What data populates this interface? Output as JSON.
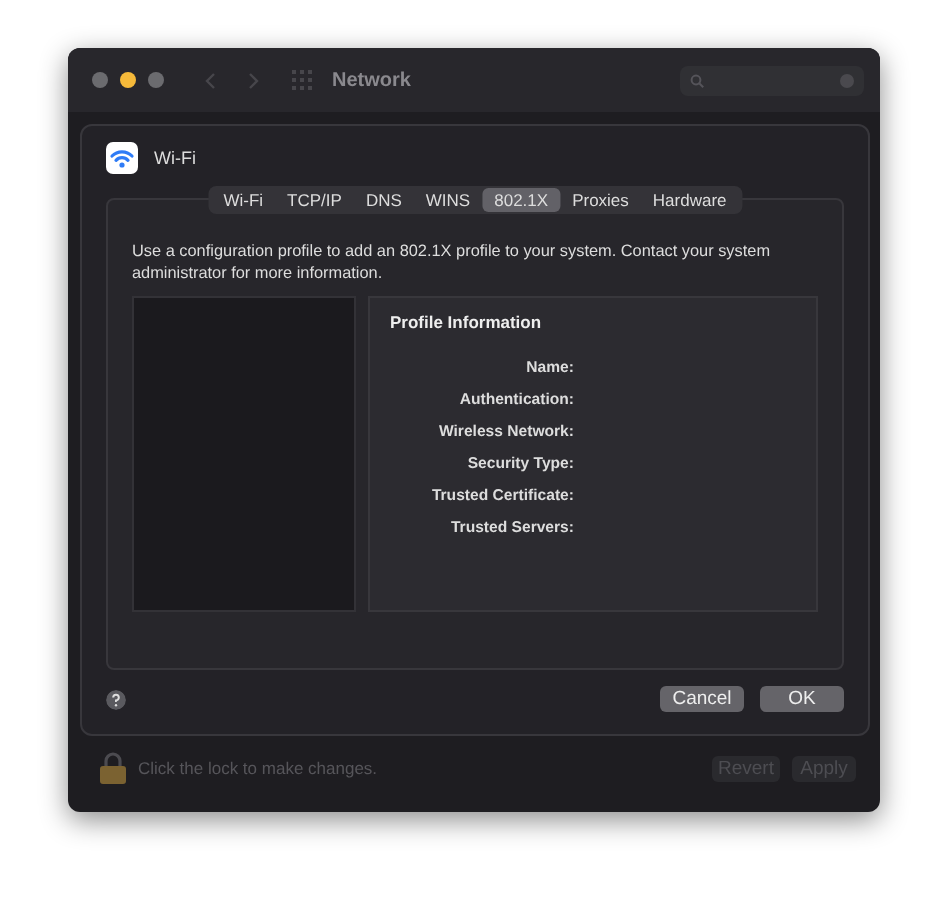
{
  "window": {
    "title": "Network",
    "lights": [
      {
        "color": "#6b6b6f"
      },
      {
        "color": "#f5b93a"
      },
      {
        "color": "#6b6b6f"
      }
    ]
  },
  "sheet": {
    "service": "Wi-Fi",
    "tabs": [
      {
        "label": "Wi-Fi",
        "selected": false
      },
      {
        "label": "TCP/IP",
        "selected": false
      },
      {
        "label": "DNS",
        "selected": false
      },
      {
        "label": "WINS",
        "selected": false
      },
      {
        "label": "802.1X",
        "selected": true
      },
      {
        "label": "Proxies",
        "selected": false
      },
      {
        "label": "Hardware",
        "selected": false
      }
    ],
    "description": "Use a configuration profile to add an 802.1X profile to your system. Contact your system administrator for more information.",
    "profile": {
      "title": "Profile Information",
      "fields": [
        "Name:",
        "Authentication:",
        "Wireless Network:",
        "Security Type:",
        "Trusted Certificate:",
        "Trusted Servers:"
      ]
    },
    "buttons": [
      {
        "label": "Cancel",
        "disabled": false
      },
      {
        "label": "OK",
        "disabled": false
      }
    ]
  },
  "status_bar": {
    "lock_text": "Click the lock to make changes.",
    "buttons": [
      {
        "label": "Revert",
        "disabled": true
      },
      {
        "label": "Apply",
        "disabled": true
      }
    ]
  }
}
